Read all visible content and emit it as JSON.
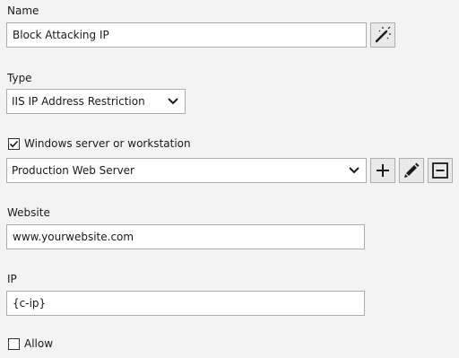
{
  "name_section": {
    "label": "Name",
    "value": "Block Attacking IP",
    "wand_icon": "magic-wand-icon"
  },
  "type_section": {
    "label": "Type",
    "selected": "IIS IP Address Restriction"
  },
  "server_section": {
    "checkbox_label": "Windows server or workstation",
    "checked": true,
    "selected": "Production Web Server",
    "icons": [
      "plus-icon",
      "pencil-icon",
      "minus-box-icon"
    ]
  },
  "website_section": {
    "label": "Website",
    "value": "www.yourwebsite.com"
  },
  "ip_section": {
    "label": "IP",
    "value": "{c-ip}"
  },
  "allow_section": {
    "checkbox_label": "Allow",
    "checked": false
  }
}
